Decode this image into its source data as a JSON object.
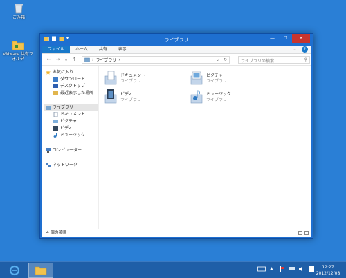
{
  "desktop": {
    "recycle_bin_label": "ごみ箱",
    "vmware_label": "VMware 共有フォルダ"
  },
  "window": {
    "title": "ライブラリ",
    "minimize": "—",
    "maximize": "☐",
    "close": "✕"
  },
  "ribbon": {
    "tabs": [
      "ファイル",
      "ホーム",
      "共有",
      "表示"
    ],
    "help": "?"
  },
  "address": {
    "back": "←",
    "forward": "→",
    "up": "↑",
    "recent": "⌄",
    "separator": "›",
    "path": "ライブラリ",
    "tail": "›",
    "dropdown": "⌄",
    "refresh": "↻",
    "search_placeholder": "ライブラリの検索",
    "search_icon": "⚲"
  },
  "nav": {
    "favorites": "お気に入り",
    "downloads": "ダウンロード",
    "desktop": "デスクトップ",
    "recent": "最近表示した場所",
    "libraries": "ライブラリ",
    "documents": "ドキュメント",
    "pictures": "ピクチャ",
    "videos": "ビデオ",
    "music": "ミュージック",
    "computer": "コンピューター",
    "network": "ネットワーク"
  },
  "libraries": [
    {
      "name": "ドキュメント",
      "type": "ライブラリ",
      "icon": "documents-library-icon"
    },
    {
      "name": "ピクチャ",
      "type": "ライブラリ",
      "icon": "pictures-library-icon"
    },
    {
      "name": "ビデオ",
      "type": "ライブラリ",
      "icon": "videos-library-icon"
    },
    {
      "name": "ミュージック",
      "type": "ライブラリ",
      "icon": "music-library-icon"
    }
  ],
  "status": {
    "count": "4 個の項目"
  },
  "taskbar": {
    "time": "12:27",
    "date": "2012/12/08"
  },
  "colors": {
    "desktop": "#2a7fd6",
    "window_frame": "#1e6fd0",
    "close": "#c7342d",
    "file_tab": "#1979ca",
    "taskbar": "#1f5fa8"
  }
}
